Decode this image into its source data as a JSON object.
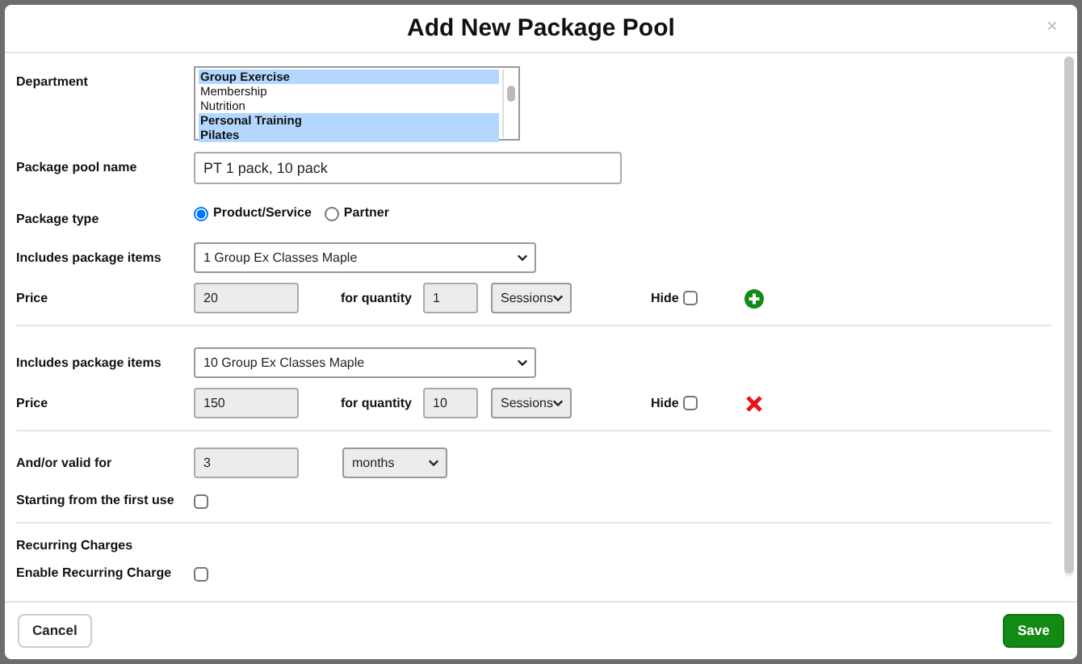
{
  "dialog": {
    "title": "Add New Package Pool",
    "close": "×"
  },
  "department": {
    "label": "Department",
    "options": [
      {
        "label": "Group Exercise",
        "selected": true
      },
      {
        "label": "Membership",
        "selected": false
      },
      {
        "label": "Nutrition",
        "selected": false
      },
      {
        "label": "Personal Training",
        "selected": true
      },
      {
        "label": "Pilates",
        "selected": true
      }
    ]
  },
  "package_pool_name": {
    "label": "Package pool name",
    "value": "PT 1 pack, 10 pack"
  },
  "package_type": {
    "label": "Package type",
    "options": [
      {
        "label": "Product/Service",
        "selected": true
      },
      {
        "label": "Partner",
        "selected": false
      }
    ]
  },
  "package_items": [
    {
      "label": "Includes package items",
      "value": "1 Group Ex Classes Maple",
      "price_label": "Price",
      "price": "20",
      "quantity_label": "for quantity",
      "quantity": "1",
      "unit": "Sessions",
      "hide_label": "Hide",
      "hidden": false,
      "kind": "add"
    },
    {
      "label": "Includes package items",
      "value": "10 Group Ex Classes Maple",
      "price_label": "Price",
      "price": "150",
      "quantity_label": "for quantity",
      "quantity": "10",
      "unit": "Sessions",
      "hide_label": "Hide",
      "hidden": false,
      "kind": "remove"
    }
  ],
  "validity": {
    "label": "And/or valid for",
    "value": "3",
    "unit": "months"
  },
  "first_use": {
    "label": "Starting from the first use",
    "checked": false
  },
  "recurring": {
    "heading": "Recurring Charges",
    "enable_label": "Enable Recurring Charge",
    "enabled": false
  },
  "buttons": [
    {
      "label": "Cancel",
      "kind": "secondary"
    },
    {
      "label": "Save",
      "kind": "primary"
    }
  ]
}
